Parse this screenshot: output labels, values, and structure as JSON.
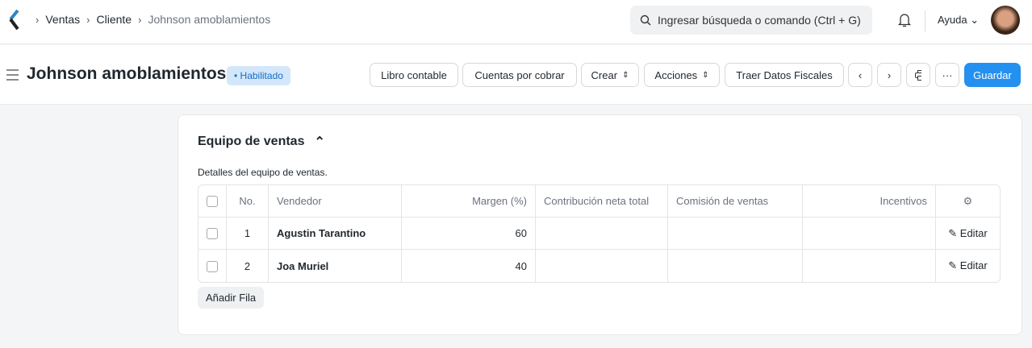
{
  "breadcrumb": [
    "Ventas",
    "Cliente",
    "Johnson amoblamientos"
  ],
  "search": {
    "placeholder": "Ingresar búsqueda o comando (Ctrl + G)"
  },
  "help": "Ayuda",
  "title": "Johnson amoblamientos",
  "status": "Habilitado",
  "buttons": {
    "ledger": "Libro contable",
    "receivable": "Cuentas por cobrar",
    "create": "Crear",
    "actions": "Acciones",
    "fiscal": "Traer Datos Fiscales",
    "more": "···",
    "save": "Guardar"
  },
  "section": {
    "title": "Equipo de ventas",
    "description": "Detalles del equipo de ventas.",
    "columns": [
      "No.",
      "Vendedor",
      "Margen (%)",
      "Contribución neta total",
      "Comisión de ventas",
      "Incentivos"
    ],
    "rows": [
      {
        "no": "1",
        "name": "Agustin Tarantino",
        "margin": "60"
      },
      {
        "no": "2",
        "name": "Joa Muriel",
        "margin": "40"
      }
    ],
    "edit": "Editar",
    "add_row": "Añadir Fila"
  },
  "colors": {
    "accent": "#2490ef"
  }
}
